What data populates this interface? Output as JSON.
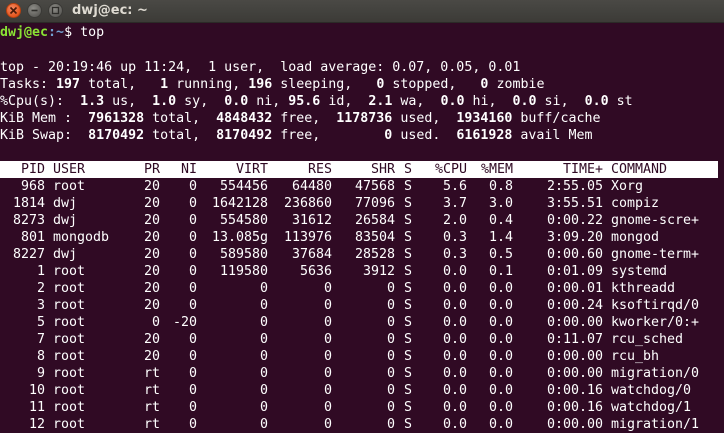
{
  "window": {
    "title": "dwj@ec: ~"
  },
  "prompt": {
    "user_host": "dwj@ec",
    "path": ":~",
    "symbol": "$",
    "command": "top"
  },
  "summary": {
    "l1": {
      "text": "top - 20:19:46 up 11:24,  1 user,  load average: 0.07, 0.05, 0.01"
    },
    "l2": {
      "a": "Tasks: ",
      "v1": "197",
      "b": " total,   ",
      "v2": "1",
      "c": " running, ",
      "v3": "196",
      "d": " sleeping,   ",
      "v4": "0",
      "e": " stopped,   ",
      "v5": "0",
      "f": " zombie"
    },
    "l3": {
      "a": "%Cpu(s):  ",
      "v1": "1.3",
      "b": " us,  ",
      "v2": "1.0",
      "c": " sy,  ",
      "v3": "0.0",
      "d": " ni, ",
      "v4": "95.6",
      "e": " id,  ",
      "v5": "2.1",
      "f": " wa,  ",
      "v6": "0.0",
      "g": " hi,  ",
      "v7": "0.0",
      "h": " si,  ",
      "v8": "0.0",
      "i": " st"
    },
    "l4": {
      "a": "KiB Mem :  ",
      "v1": "7961328",
      "b": " total,  ",
      "v2": "4848432",
      "c": " free,  ",
      "v3": "1178736",
      "d": " used,  ",
      "v4": "1934160",
      "e": " buff/cache"
    },
    "l5": {
      "a": "KiB Swap:  ",
      "v1": "8170492",
      "b": " total,  ",
      "v2": "8170492",
      "c": " free,        ",
      "v3": "0",
      "d": " used.  ",
      "v4": "6161928",
      "e": " avail Mem"
    }
  },
  "columns": [
    "PID",
    "USER",
    "PR",
    "NI",
    "VIRT",
    "RES",
    "SHR",
    "S",
    "%CPU",
    "%MEM",
    "TIME+",
    "COMMAND"
  ],
  "processes": [
    {
      "pid": "968",
      "user": "root",
      "pr": "20",
      "ni": "0",
      "virt": "554456",
      "res": "64480",
      "shr": "47568",
      "s": "S",
      "cpu": "5.6",
      "mem": "0.8",
      "time": "2:55.05",
      "cmd": "Xorg"
    },
    {
      "pid": "1814",
      "user": "dwj",
      "pr": "20",
      "ni": "0",
      "virt": "1642128",
      "res": "236860",
      "shr": "77096",
      "s": "S",
      "cpu": "3.7",
      "mem": "3.0",
      "time": "3:55.51",
      "cmd": "compiz"
    },
    {
      "pid": "8273",
      "user": "dwj",
      "pr": "20",
      "ni": "0",
      "virt": "554580",
      "res": "31612",
      "shr": "26584",
      "s": "S",
      "cpu": "2.0",
      "mem": "0.4",
      "time": "0:00.22",
      "cmd": "gnome-scre+"
    },
    {
      "pid": "801",
      "user": "mongodb",
      "pr": "20",
      "ni": "0",
      "virt": "13.085g",
      "res": "113976",
      "shr": "83504",
      "s": "S",
      "cpu": "0.3",
      "mem": "1.4",
      "time": "3:09.20",
      "cmd": "mongod"
    },
    {
      "pid": "8227",
      "user": "dwj",
      "pr": "20",
      "ni": "0",
      "virt": "589580",
      "res": "37684",
      "shr": "28528",
      "s": "S",
      "cpu": "0.3",
      "mem": "0.5",
      "time": "0:00.60",
      "cmd": "gnome-term+"
    },
    {
      "pid": "1",
      "user": "root",
      "pr": "20",
      "ni": "0",
      "virt": "119580",
      "res": "5636",
      "shr": "3912",
      "s": "S",
      "cpu": "0.0",
      "mem": "0.1",
      "time": "0:01.09",
      "cmd": "systemd"
    },
    {
      "pid": "2",
      "user": "root",
      "pr": "20",
      "ni": "0",
      "virt": "0",
      "res": "0",
      "shr": "0",
      "s": "S",
      "cpu": "0.0",
      "mem": "0.0",
      "time": "0:00.01",
      "cmd": "kthreadd"
    },
    {
      "pid": "3",
      "user": "root",
      "pr": "20",
      "ni": "0",
      "virt": "0",
      "res": "0",
      "shr": "0",
      "s": "S",
      "cpu": "0.0",
      "mem": "0.0",
      "time": "0:00.24",
      "cmd": "ksoftirqd/0"
    },
    {
      "pid": "5",
      "user": "root",
      "pr": "0",
      "ni": "-20",
      "virt": "0",
      "res": "0",
      "shr": "0",
      "s": "S",
      "cpu": "0.0",
      "mem": "0.0",
      "time": "0:00.00",
      "cmd": "kworker/0:+"
    },
    {
      "pid": "7",
      "user": "root",
      "pr": "20",
      "ni": "0",
      "virt": "0",
      "res": "0",
      "shr": "0",
      "s": "S",
      "cpu": "0.0",
      "mem": "0.0",
      "time": "0:11.07",
      "cmd": "rcu_sched"
    },
    {
      "pid": "8",
      "user": "root",
      "pr": "20",
      "ni": "0",
      "virt": "0",
      "res": "0",
      "shr": "0",
      "s": "S",
      "cpu": "0.0",
      "mem": "0.0",
      "time": "0:00.00",
      "cmd": "rcu_bh"
    },
    {
      "pid": "9",
      "user": "root",
      "pr": "rt",
      "ni": "0",
      "virt": "0",
      "res": "0",
      "shr": "0",
      "s": "S",
      "cpu": "0.0",
      "mem": "0.0",
      "time": "0:00.00",
      "cmd": "migration/0"
    },
    {
      "pid": "10",
      "user": "root",
      "pr": "rt",
      "ni": "0",
      "virt": "0",
      "res": "0",
      "shr": "0",
      "s": "S",
      "cpu": "0.0",
      "mem": "0.0",
      "time": "0:00.16",
      "cmd": "watchdog/0"
    },
    {
      "pid": "11",
      "user": "root",
      "pr": "rt",
      "ni": "0",
      "virt": "0",
      "res": "0",
      "shr": "0",
      "s": "S",
      "cpu": "0.0",
      "mem": "0.0",
      "time": "0:00.16",
      "cmd": "watchdog/1"
    },
    {
      "pid": "12",
      "user": "root",
      "pr": "rt",
      "ni": "0",
      "virt": "0",
      "res": "0",
      "shr": "0",
      "s": "S",
      "cpu": "0.0",
      "mem": "0.0",
      "time": "0:00.00",
      "cmd": "migration/1"
    }
  ]
}
